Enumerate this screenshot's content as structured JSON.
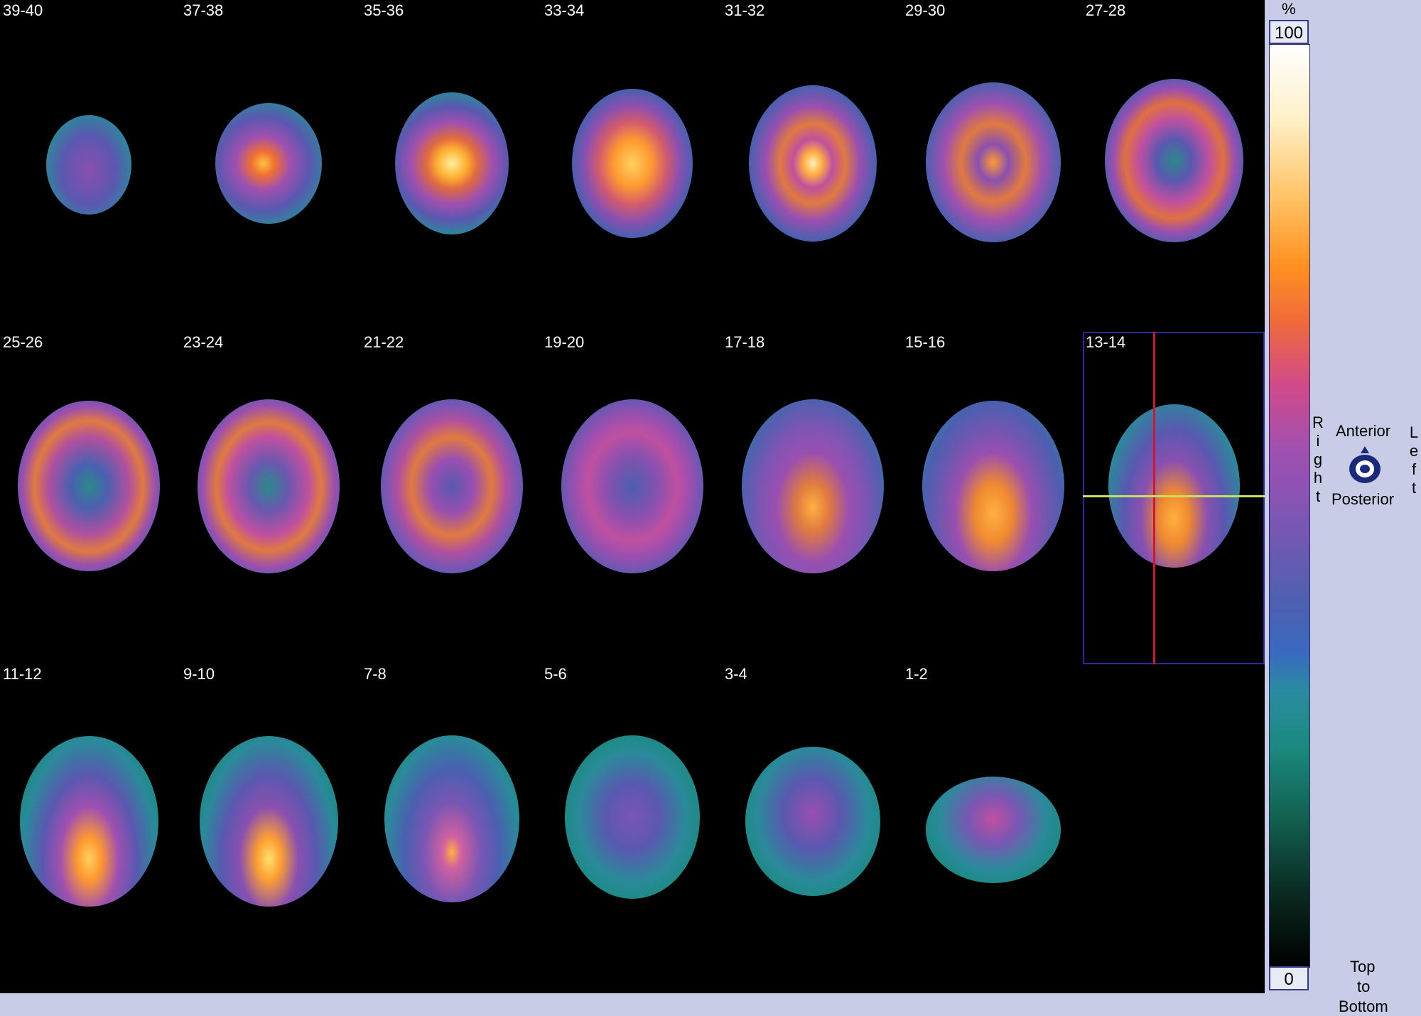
{
  "slice_labels": [
    "39-40",
    "37-38",
    "35-36",
    "33-34",
    "31-32",
    "29-30",
    "27-28",
    "25-26",
    "23-24",
    "21-22",
    "19-20",
    "17-18",
    "15-16",
    "13-14",
    "11-12",
    "9-10",
    "7-8",
    "5-6",
    "3-4",
    "1-2"
  ],
  "selected_slice": "13-14",
  "colors": {
    "background": "#000000",
    "panel": "#c9cce6",
    "selection_box": "#2a2a9a",
    "crosshair_vertical": "#d0182a",
    "crosshair_horizontal": "#c8e060"
  },
  "colorbar": {
    "unit": "%",
    "max_label": "100",
    "min_label": "0"
  },
  "orientation": {
    "right": "Right",
    "left": "Left",
    "anterior": "Anterior",
    "posterior": "Posterior",
    "icon": "head-orientation-icon"
  },
  "order": {
    "line1": "Top",
    "line2": "to",
    "line3": "Bottom"
  }
}
